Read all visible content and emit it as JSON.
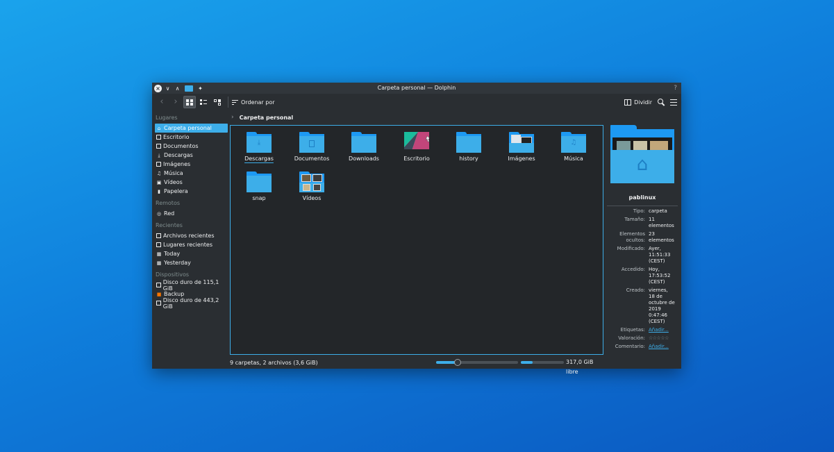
{
  "window": {
    "title": "Carpeta personal — Dolphin",
    "help": "?"
  },
  "toolbar": {
    "sort_label": "Ordenar por",
    "split_label": "Dividir"
  },
  "sidebar": {
    "sections": [
      {
        "title": "Lugares",
        "items": [
          {
            "label": "Carpeta personal",
            "icon": "home-icon",
            "active": true
          },
          {
            "label": "Escritorio",
            "icon": "desktop-icon"
          },
          {
            "label": "Documentos",
            "icon": "documents-icon"
          },
          {
            "label": "Descargas",
            "icon": "downloads-icon"
          },
          {
            "label": "Imágenes",
            "icon": "pictures-icon"
          },
          {
            "label": "Música",
            "icon": "music-icon"
          },
          {
            "label": "Vídeos",
            "icon": "videos-icon"
          },
          {
            "label": "Papelera",
            "icon": "trash-icon"
          }
        ]
      },
      {
        "title": "Remotos",
        "items": [
          {
            "label": "Red",
            "icon": "network-icon"
          }
        ]
      },
      {
        "title": "Recientes",
        "items": [
          {
            "label": "Archivos recientes",
            "icon": "recent-files-icon"
          },
          {
            "label": "Lugares recientes",
            "icon": "recent-places-icon"
          },
          {
            "label": "Today",
            "icon": "calendar-icon"
          },
          {
            "label": "Yesterday",
            "icon": "calendar-icon"
          }
        ]
      },
      {
        "title": "Dispositivos",
        "items": [
          {
            "label": "Disco duro de 115,1 GiB",
            "icon": "hard-disk-icon"
          },
          {
            "label": "Backup",
            "icon": "backup-drive-icon"
          },
          {
            "label": "Disco duro de 443,2 GiB",
            "icon": "hard-disk-icon"
          }
        ]
      }
    ]
  },
  "breadcrumb": {
    "current": "Carpeta personal"
  },
  "files": [
    {
      "name": "Descargas",
      "type": "downloads"
    },
    {
      "name": "Documentos",
      "type": "documents"
    },
    {
      "name": "Downloads",
      "type": "folder"
    },
    {
      "name": "Escritorio",
      "type": "desktop"
    },
    {
      "name": "history",
      "type": "folder"
    },
    {
      "name": "Imágenes",
      "type": "pictures"
    },
    {
      "name": "Música",
      "type": "music"
    },
    {
      "name": "snap",
      "type": "folder"
    },
    {
      "name": "Vídeos",
      "type": "videos"
    }
  ],
  "status": {
    "summary": "9 carpetas, 2 archivos (3,6 GiB)",
    "free_space": "317,0 GiB libre",
    "zoom_level": 0.26,
    "used_space_fraction": 0.28
  },
  "info_panel": {
    "name": "pablinux",
    "rows": [
      {
        "key": "Tipo:",
        "value": "carpeta"
      },
      {
        "key": "Tamaño:",
        "value": "11 elementos"
      },
      {
        "key": "Elementos ocultos:",
        "value": "23 elementos"
      },
      {
        "key": "Modificado:",
        "value": "Ayer, 11:51:33 (CEST)"
      },
      {
        "key": "Accedido:",
        "value": "Hoy, 17:53:52 (CEST)"
      },
      {
        "key": "Creado:",
        "value": "viernes, 18 de octubre de 2019 0:47:46 (CEST)"
      }
    ],
    "tags_key": "Etiquetas:",
    "tags_link": "Añadir...",
    "rating_key": "Valoración:",
    "rating_value": 0,
    "rating_max": 5,
    "comment_key": "Comentario:",
    "comment_link": "Añadir..."
  },
  "colors": {
    "accent": "#3daee9",
    "folder_dark": "#1d99f3",
    "window_bg": "#2a2e32",
    "view_bg": "#232629"
  }
}
